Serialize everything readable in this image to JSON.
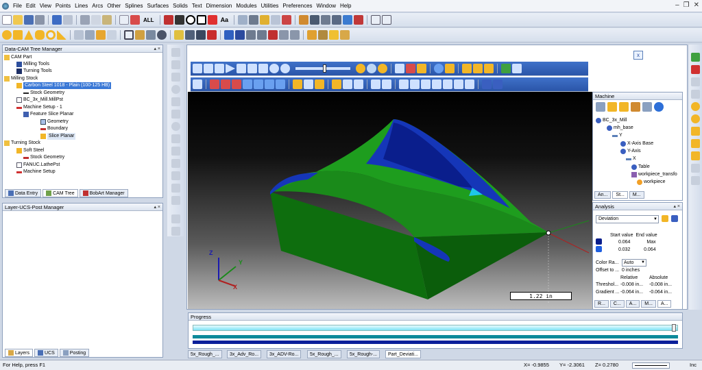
{
  "menu": [
    "File",
    "Edit",
    "View",
    "Points",
    "Lines",
    "Arcs",
    "Other",
    "Splines",
    "Surfaces",
    "Solids",
    "Text",
    "Dimension",
    "Modules",
    "Utilities",
    "Preferences",
    "Window",
    "Help"
  ],
  "toolbar": {
    "all_label": "ALL",
    "text_label": "Aa"
  },
  "cam_manager": {
    "title": "Data-CAM Tree Manager",
    "items": [
      "CAM Part",
      "Milling Tools",
      "Turning Tools",
      "Milling Stock",
      "Carbon Steel 1018 - Plain (100-125 HB)",
      "Stock Geometry",
      "BC_3x_Mill.MillPst",
      "Machine Setup - 1",
      "Feature Slice Planar",
      "Geometry",
      "Boundary",
      "Slice Planar",
      "Turning Stock",
      "Soft Steel",
      "Stock Geometry",
      "FANUC.LathePst",
      "Machine Setup"
    ],
    "tabs": [
      "Data Entry",
      "CAM Tree",
      "BobArt Manager"
    ]
  },
  "layer_manager": {
    "title": "Layer-UCS-Post Manager",
    "tabs": [
      "Layers",
      "UCS",
      "Posting"
    ]
  },
  "viewport": {
    "scale_label": "1.22 in",
    "axis_x": "X",
    "axis_y": "Y",
    "axis_z": "Z",
    "close_label": "x"
  },
  "machine": {
    "title": "Machine",
    "items": [
      "BC_3x_Mill",
      "mh_base",
      "Y",
      "X-Axis Base",
      "Y-Axis",
      "X",
      "Table",
      "workpiece_transfo",
      "workpiece"
    ],
    "tabs": [
      "An...",
      "St...",
      "M..."
    ]
  },
  "analysis": {
    "title": "Analysis",
    "mode": "Deviation",
    "headers": [
      "Start value",
      "End value"
    ],
    "rows": [
      {
        "color": "#0a1e8c",
        "start": "0.064",
        "end": "Max"
      },
      {
        "color": "#1f5fe0",
        "start": "0.032",
        "end": "0.064"
      }
    ],
    "color_range_label": "Color Ra...",
    "color_range_value": "Auto",
    "offset_label": "Offset to ...",
    "offset_value": "0 inches",
    "cols": [
      "Relative",
      "Absolute"
    ],
    "props": [
      {
        "label": "Threshol...",
        "rel": "-0.008 in...",
        "abs": "-0.008 in..."
      },
      {
        "label": "Gradient ...",
        "rel": "-0.064 in...",
        "abs": "-0.064 in..."
      }
    ],
    "tabs": [
      "R...",
      "C...",
      "A...",
      "M...",
      "A..."
    ]
  },
  "progress": {
    "title": "Progress"
  },
  "doc_tabs": [
    "5x_Rough_...",
    "3x_Adv_Ro...",
    "3x_ADV-Ro...",
    "5x_Rough_...",
    "5x_Rough-...",
    "Part_Deviati..."
  ],
  "status": {
    "help": "For Help, press F1",
    "x": "X= -0.9855",
    "y": "Y= -2.3061",
    "z": "Z= 0.2780",
    "unit": "Inc"
  }
}
